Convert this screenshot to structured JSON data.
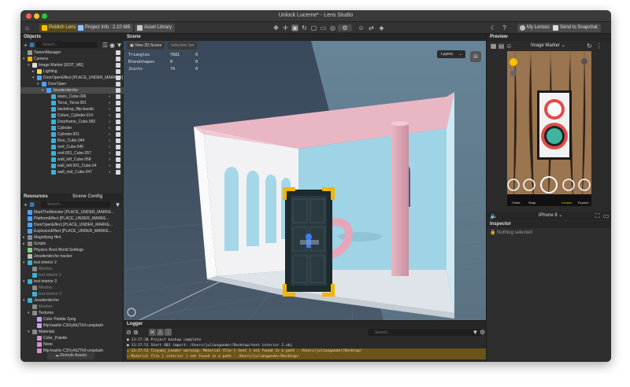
{
  "window": {
    "title": "Unlock Lucerne* - Lens Studio"
  },
  "toolbar": {
    "publish_label": "Publish Lens",
    "project_info_label": "Project Info",
    "size_label": "2.10 MB",
    "asset_library_label": "Asset Library",
    "my_lenses_label": "My Lenses",
    "send_label": "Send to Snapchat"
  },
  "objects": {
    "title": "Objects",
    "search_placeholder": "Search...",
    "items": [
      {
        "label": "TweenManager",
        "depth": 0,
        "icon": "script"
      },
      {
        "label": "Camera",
        "depth": 0,
        "icon": "camera",
        "arrow": "▾"
      },
      {
        "label": "Image Marker [EDIT_ME]",
        "depth": 1,
        "icon": "marker",
        "arrow": "▾"
      },
      {
        "label": "Lighting",
        "depth": 2,
        "icon": "light",
        "arrow": "▸"
      },
      {
        "label": "DoorOpenEffect [PLACE_UNDER_MARKER]",
        "depth": 2,
        "icon": "obj",
        "arrow": "▾"
      },
      {
        "label": "DoorOpen",
        "depth": 3,
        "icon": "obj",
        "arrow": "▾"
      },
      {
        "label": "Jesuitenkirche",
        "depth": 4,
        "icon": "obj",
        "arrow": "▾",
        "selected": true
      },
      {
        "label": "stairs_Cube.006",
        "depth": 5,
        "icon": "mesh"
      },
      {
        "label": "Torus_Torus.001",
        "depth": 5,
        "icon": "mesh"
      },
      {
        "label": "backdrop_filip-basitic",
        "depth": 5,
        "icon": "mesh"
      },
      {
        "label": "Colum_Cylinder.014",
        "depth": 5,
        "icon": "mesh"
      },
      {
        "label": "Doorframe_Cube.060",
        "depth": 5,
        "icon": "mesh"
      },
      {
        "label": "Cylinder",
        "depth": 5,
        "icon": "mesh"
      },
      {
        "label": "Cylinder.001",
        "depth": 5,
        "icon": "mesh"
      },
      {
        "label": "floor_Cube.044",
        "depth": 5,
        "icon": "mesh"
      },
      {
        "label": "roof_Cube.045",
        "depth": 5,
        "icon": "mesh"
      },
      {
        "label": "roof.001_Cube.057",
        "depth": 5,
        "icon": "mesh"
      },
      {
        "label": "wall_left_Cube.058",
        "depth": 5,
        "icon": "mesh"
      },
      {
        "label": "wall_left.001_Cube.04",
        "depth": 5,
        "icon": "mesh"
      },
      {
        "label": "wall_mid_Cube.047",
        "depth": 5,
        "icon": "mesh"
      }
    ]
  },
  "resources": {
    "tab_resources": "Resources",
    "tab_scene_config": "Scene Config",
    "search_placeholder": "Search...",
    "items": [
      {
        "label": "MarkTheMonster [PLACE_UNDER_MARKE...",
        "depth": 0,
        "icon": "prefab"
      },
      {
        "label": "PlatformEffect [PLACE_UNDER_MARKE...",
        "depth": 0,
        "icon": "prefab"
      },
      {
        "label": "DoorOpenEffect [PLACE_UNDER_MARKE...",
        "depth": 0,
        "icon": "prefab"
      },
      {
        "label": "ExplosionEffect [PLACE_UNDER_MARKE...",
        "depth": 0,
        "icon": "prefab"
      },
      {
        "label": "Magnifying Hint",
        "depth": 0,
        "icon": "folder",
        "arrow": "▸"
      },
      {
        "label": "Scripts",
        "depth": 0,
        "icon": "folder",
        "arrow": "▸"
      },
      {
        "label": "Physics Root World Settings",
        "depth": 0,
        "icon": "physics"
      },
      {
        "label": "Jesuitenkirche tracker",
        "depth": 0,
        "icon": "tracker"
      },
      {
        "label": "test interior 2",
        "depth": 0,
        "icon": "mesh",
        "arrow": "▾"
      },
      {
        "label": "Meshes",
        "depth": 1,
        "icon": "folder",
        "dim": true
      },
      {
        "label": "test interior 2",
        "depth": 1,
        "icon": "mesh",
        "dim": true
      },
      {
        "label": "test interior 3",
        "depth": 0,
        "icon": "mesh",
        "arrow": "▾"
      },
      {
        "label": "Meshes",
        "depth": 1,
        "icon": "folder",
        "dim": true
      },
      {
        "label": "test interior 3",
        "depth": 1,
        "icon": "mesh",
        "dim": true
      },
      {
        "label": "Jesuitenkirche",
        "depth": 0,
        "icon": "mesh",
        "arrow": "▾"
      },
      {
        "label": "Meshes",
        "depth": 1,
        "icon": "folder",
        "dim": true
      },
      {
        "label": "Textures",
        "depth": 1,
        "icon": "folder",
        "arrow": "▾"
      },
      {
        "label": "Color Palette 2png",
        "depth": 2,
        "icon": "texture"
      },
      {
        "label": "filip-basitic-C3Oy6kZTk0-unsplash",
        "depth": 2,
        "icon": "texture"
      },
      {
        "label": "Materials",
        "depth": 1,
        "icon": "folder",
        "arrow": "▾"
      },
      {
        "label": "Color_Palette",
        "depth": 2,
        "icon": "material"
      },
      {
        "label": "None",
        "depth": 2,
        "icon": "material"
      },
      {
        "label": "filip-basitic-C3Oy6kZTk0-unsplash",
        "depth": 2,
        "icon": "material"
      }
    ],
    "remote_assets_label": "Remote Assets"
  },
  "scene": {
    "title": "Scene",
    "view_2d_label": "View 2D Scene",
    "selection_set_label": "Selection Set",
    "stats": [
      {
        "label": "Triangles",
        "value": "7681",
        "extra": "0"
      },
      {
        "label": "Blendshapes",
        "value": "0",
        "extra": "0"
      },
      {
        "label": "Joints",
        "value": "74",
        "extra": "0"
      }
    ],
    "layers_label": "Layers"
  },
  "preview": {
    "title": "Preview",
    "mode_label": "Image Marker",
    "device_label": "iPhone 8",
    "modes": [
      "Chats",
      "Snap",
      "",
      "Lenses",
      "Explore"
    ]
  },
  "inspector": {
    "title": "Inspector",
    "empty_label": "Nothing selected"
  },
  "logger": {
    "title": "Logger",
    "search_placeholder": "Search...",
    "lines": [
      {
        "time": "13:17:30",
        "text": "Project backup complete",
        "level": "info"
      },
      {
        "time": "13:17:51",
        "text": "Start OBJ import: /Users/juliangander/Desktop/test interior 2.obj",
        "level": "info"
      },
      {
        "time": "13:17:51",
        "text": "Tinyobj_Loader warning: Material file [ test ] not found in a path : /Users/juliangander/Desktop/",
        "level": "warn"
      },
      {
        "time": "",
        "text": "Material file [ interior ] not found in a path : /Users/juliangander/Desktop/",
        "level": "warn"
      }
    ]
  },
  "colors": {
    "accent": "#f5c400",
    "selection": "#4a4a4a",
    "warn_bg": "#6b5418",
    "mesh_icon": "#3fb0d9",
    "folder_icon": "#8a8a8a"
  }
}
